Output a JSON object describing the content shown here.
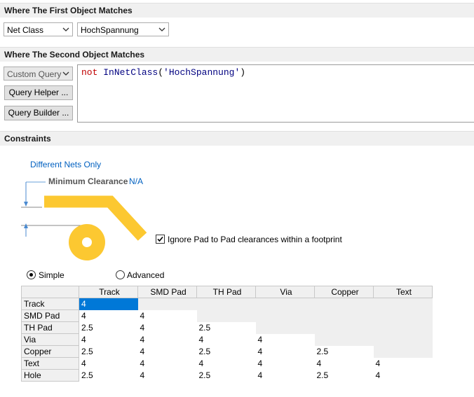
{
  "first": {
    "title": "Where The First Object Matches",
    "type_value": "Net Class",
    "value": "HochSpannung"
  },
  "second": {
    "title": "Where The Second Object Matches",
    "type_value": "Custom Query",
    "query_helper": "Query Helper ...",
    "query_builder": "Query Builder ...",
    "query_kw": "not",
    "query_fn": "InNetClass",
    "query_open": "(",
    "query_str": "'HochSpannung'",
    "query_close": ")"
  },
  "constraints": {
    "title": "Constraints",
    "different_nets": "Different Nets Only",
    "min_clearance_label": "Minimum Clearance",
    "min_clearance_value": "N/A",
    "ignore_pad_label": "Ignore Pad to Pad clearances within a footprint",
    "ignore_pad_checked": true,
    "mode_simple": "Simple",
    "mode_advanced": "Advanced",
    "selected_mode": "Simple",
    "pad_color": "#fcc831"
  },
  "grid": {
    "columns": [
      "Track",
      "SMD Pad",
      "TH Pad",
      "Via",
      "Copper",
      "Text"
    ],
    "rows": [
      {
        "label": "Track",
        "cells": [
          "4",
          "",
          "",
          "",
          "",
          ""
        ]
      },
      {
        "label": "SMD Pad",
        "cells": [
          "4",
          "4",
          "",
          "",
          "",
          ""
        ]
      },
      {
        "label": "TH Pad",
        "cells": [
          "2.5",
          "4",
          "2.5",
          "",
          "",
          ""
        ]
      },
      {
        "label": "Via",
        "cells": [
          "4",
          "4",
          "4",
          "4",
          "",
          ""
        ]
      },
      {
        "label": "Copper",
        "cells": [
          "2.5",
          "4",
          "2.5",
          "4",
          "2.5",
          ""
        ]
      },
      {
        "label": "Text",
        "cells": [
          "4",
          "4",
          "4",
          "4",
          "4",
          "4"
        ]
      },
      {
        "label": "Hole",
        "cells": [
          "2.5",
          "4",
          "2.5",
          "4",
          "2.5",
          "4"
        ]
      }
    ]
  }
}
